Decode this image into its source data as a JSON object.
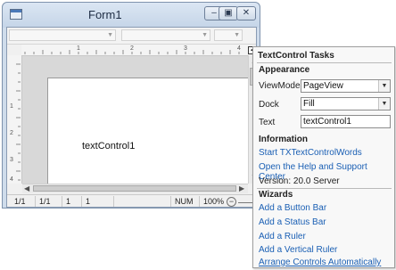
{
  "window": {
    "title": "Form1",
    "minimize_glyph": "–",
    "maximize_glyph": "▣",
    "close_glyph": "✕"
  },
  "ruler": {
    "h_numbers": [
      "1",
      "2",
      "3",
      "4"
    ],
    "v_numbers": [
      "1",
      "2",
      "3",
      "4"
    ]
  },
  "document": {
    "text": "textControl1"
  },
  "statusbar": {
    "page": "1/1",
    "section": "1/1",
    "line": "1",
    "column": "1",
    "num": "NUM",
    "zoom": "100%",
    "zoom_minus": "−"
  },
  "smart_tag_glyph": "◂",
  "tasks_panel": {
    "title": "TextControl Tasks",
    "appearance": {
      "heading": "Appearance",
      "viewmode_label": "ViewMode",
      "viewmode_value": "PageView",
      "dock_label": "Dock",
      "dock_value": "Fill",
      "text_label": "Text",
      "text_value": "textControl1"
    },
    "information": {
      "heading": "Information",
      "start_link": "Start TXTextControlWords",
      "help_link": "Open the Help and Support Center",
      "version": "Version: 20.0 Server"
    },
    "wizards": {
      "heading": "Wizards",
      "add_button_bar": "Add a Button Bar",
      "add_status_bar": "Add a Status Bar",
      "add_ruler": "Add a Ruler",
      "add_vertical_ruler": "Add a Vertical Ruler",
      "arrange_controls": "Arrange Controls Automatically"
    }
  },
  "icons": {
    "dropdown": "chevron-down-icon",
    "app": "form-icon",
    "scroll_left": "arrow-left-icon",
    "scroll_right": "arrow-right-icon",
    "scroll_up": "arrow-up-icon",
    "scroll_down": "arrow-down-icon"
  },
  "colors": {
    "link": "#1a5fb4",
    "window_frame": "#cfdceb"
  }
}
